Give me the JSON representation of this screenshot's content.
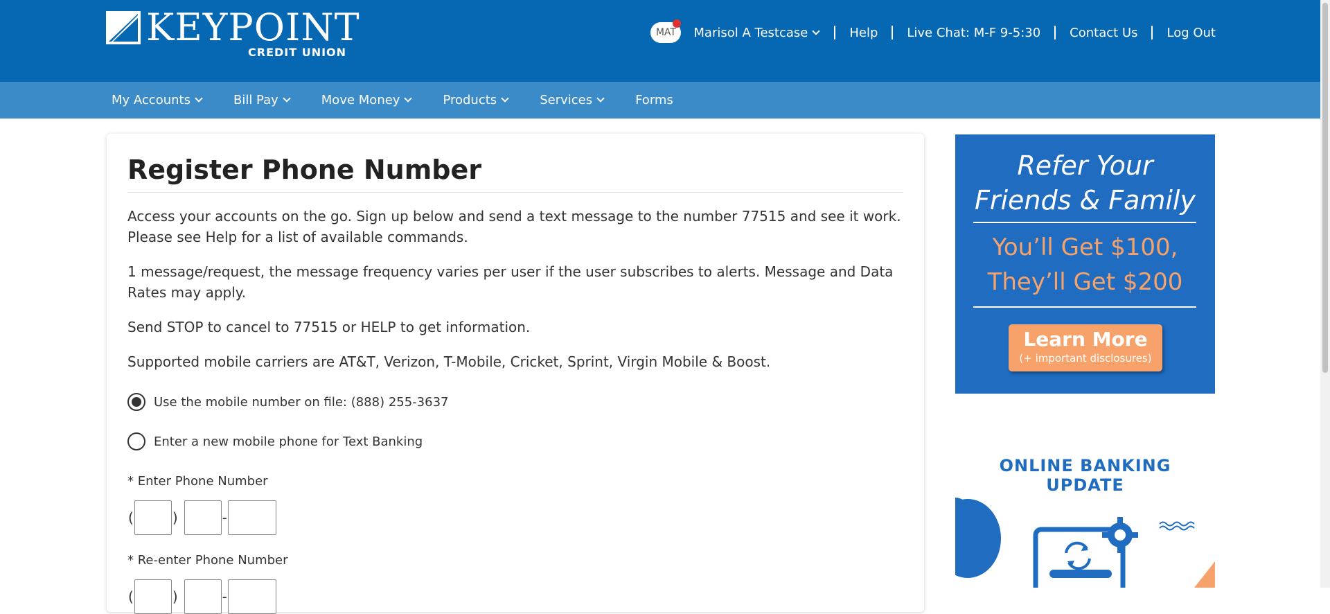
{
  "brand": {
    "name": "KEYPOINT",
    "subtitle": "CREDIT UNION"
  },
  "user_menu": {
    "initials": "MAT",
    "name": "Marisol A Testcase",
    "links": [
      "Help",
      "Live Chat: M-F 9-5:30",
      "Contact Us",
      "Log Out"
    ]
  },
  "nav": {
    "items": [
      {
        "label": "My Accounts",
        "has_dropdown": true
      },
      {
        "label": "Bill Pay",
        "has_dropdown": true
      },
      {
        "label": "Move Money",
        "has_dropdown": true
      },
      {
        "label": "Products",
        "has_dropdown": true
      },
      {
        "label": "Services",
        "has_dropdown": true
      },
      {
        "label": "Forms",
        "has_dropdown": false
      }
    ]
  },
  "main": {
    "title": "Register Phone Number",
    "paragraphs": [
      "Access your accounts on the go. Sign up below and send a text message to the number 77515 and see it work. Please see Help for a list of available commands.",
      "1 message/request, the message frequency varies per user if the user subscribes to alerts. Message and Data Rates may apply.",
      "Send STOP to cancel to 77515 or HELP to get information.",
      "Supported mobile carriers are AT&T, Verizon, T-Mobile, Cricket, Sprint, Virgin Mobile & Boost."
    ],
    "options": [
      {
        "label": "Use the mobile number on file: (888) 255-3637",
        "selected": true
      },
      {
        "label": "Enter a new mobile phone for Text Banking",
        "selected": false
      }
    ],
    "phone_label": "* Enter Phone Number",
    "phone_reenter_label": "* Re-enter Phone Number",
    "phone_value": {
      "area": "",
      "prefix": "",
      "line": ""
    },
    "phone_reenter_value": {
      "area": "",
      "prefix": "",
      "line": ""
    }
  },
  "ads": {
    "referral": {
      "heading_line1": "Refer Your",
      "heading_line2": "Friends & Family",
      "offer_line1": "You’ll Get $100,",
      "offer_line2": "They’ll Get $200",
      "button_main": "Learn More",
      "button_sub": "(+ important disclosures)"
    },
    "update": {
      "line1": "ONLINE BANKING",
      "line2": "UPDATE"
    }
  },
  "colors": {
    "header_bg": "#0668b3",
    "nav_bg": "#3a8bc7",
    "ad_blue": "#1f6cc0",
    "ad_orange": "#f7a26a",
    "notification_dot": "#e03131"
  }
}
